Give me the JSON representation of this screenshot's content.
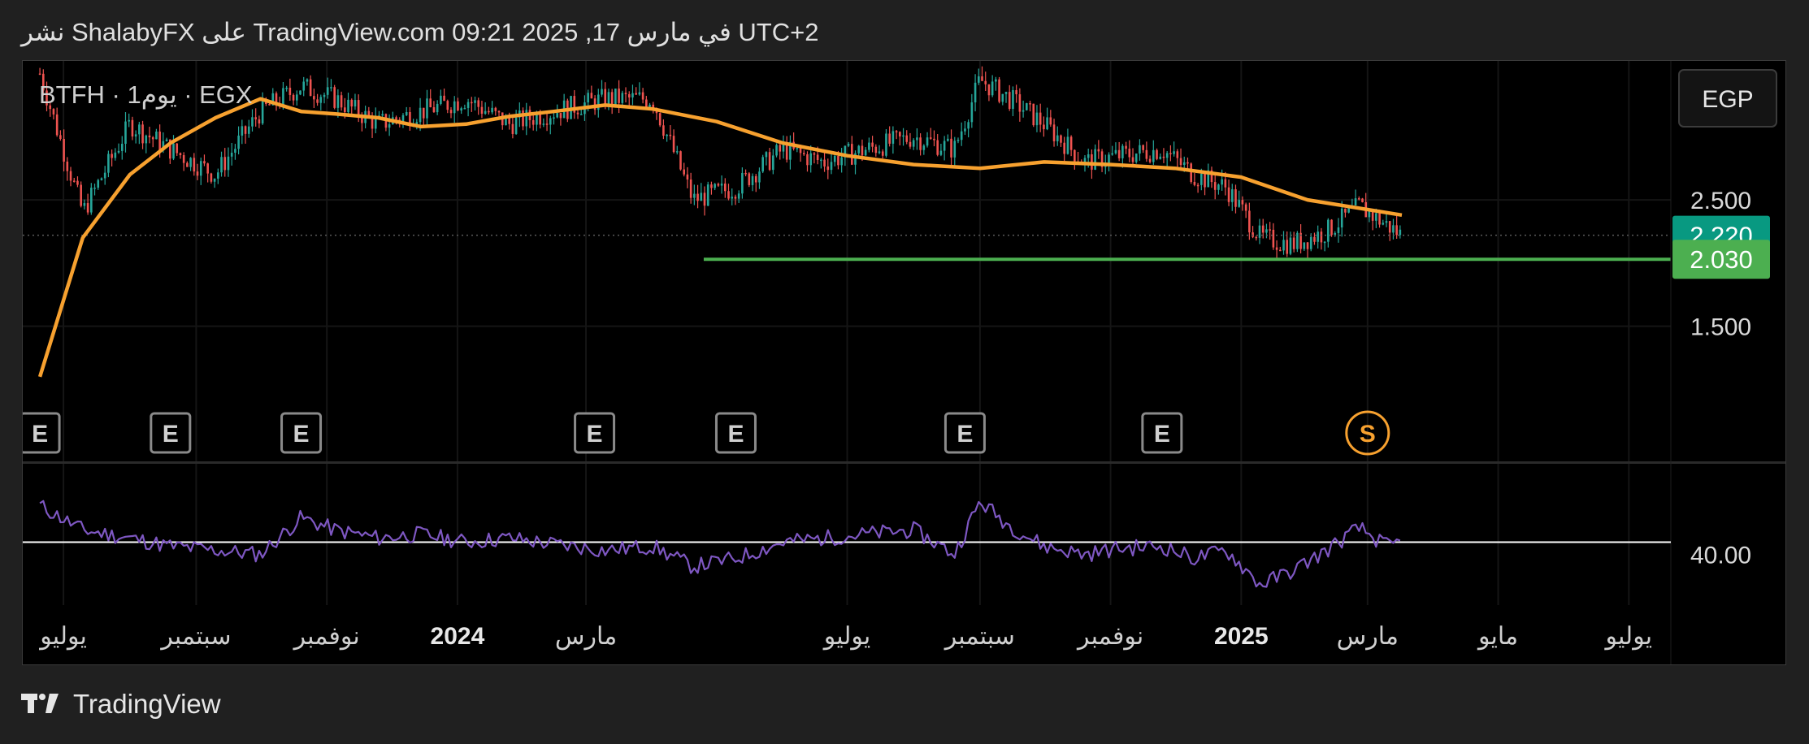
{
  "header": {
    "published_text": "نشر ShalabyFX على TradingView.com 09:21 2025 ,17 في مارس UTC+2"
  },
  "chart_data": {
    "type": "line",
    "symbol_label": "BTFH · 1يوم · EGX",
    "currency_button": "EGP",
    "colors": {
      "background": "#000000",
      "candle_up": "#26a69a",
      "candle_down": "#ef5350",
      "moving_average": "#f7a12f",
      "support_line": "#4caf50",
      "rsi_line": "#7e57c2",
      "rsi_reference": "#ffffff",
      "last_price_badge": "#089981",
      "support_badge": "#4caf50",
      "split_marker": "#f7a12f"
    },
    "price_axis": {
      "tick_labels": [
        "2.500",
        "1.500"
      ],
      "ticks": [
        2.5,
        1.5
      ],
      "ylim": [
        0.9,
        3.6
      ]
    },
    "price_badges": [
      {
        "value": "2.220",
        "kind": "last_price"
      },
      {
        "value": "2.030",
        "kind": "support"
      }
    ],
    "support_level": {
      "value": 2.03,
      "from": "2024-04-25",
      "to": "2025-06-15"
    },
    "x_axis": {
      "tick_labels": [
        {
          "label": "يوليو",
          "date": "2023-07-01",
          "bold": false
        },
        {
          "label": "سبتمبر",
          "date": "2023-09-01",
          "bold": false
        },
        {
          "label": "نوفمبر",
          "date": "2023-11-01",
          "bold": false
        },
        {
          "label": "2024",
          "date": "2024-01-01",
          "bold": true
        },
        {
          "label": "مارس",
          "date": "2024-03-01",
          "bold": false
        },
        {
          "label": "يوليو",
          "date": "2024-07-01",
          "bold": false
        },
        {
          "label": "سبتمبر",
          "date": "2024-09-01",
          "bold": false
        },
        {
          "label": "نوفمبر",
          "date": "2024-11-01",
          "bold": false
        },
        {
          "label": "2025",
          "date": "2025-01-01",
          "bold": true
        },
        {
          "label": "مارس",
          "date": "2025-03-01",
          "bold": false
        },
        {
          "label": "مايو",
          "date": "2025-05-01",
          "bold": false
        },
        {
          "label": "يوليو",
          "date": "2025-07-01",
          "bold": false
        }
      ]
    },
    "price_series": {
      "name": "",
      "dates": [
        "2023-06-20",
        "2023-07-10",
        "2023-08-01",
        "2023-08-20",
        "2023-09-10",
        "2023-10-01",
        "2023-10-20",
        "2023-11-05",
        "2023-11-25",
        "2023-12-15",
        "2024-01-05",
        "2024-01-25",
        "2024-02-15",
        "2024-03-10",
        "2024-04-01",
        "2024-04-20",
        "2024-05-10",
        "2024-06-01",
        "2024-06-20",
        "2024-07-10",
        "2024-08-01",
        "2024-08-20",
        "2024-09-01",
        "2024-09-15",
        "2024-10-01",
        "2024-10-20",
        "2024-11-05",
        "2024-11-25",
        "2024-12-10",
        "2024-12-25",
        "2025-01-10",
        "2025-01-25",
        "2025-02-10",
        "2025-02-25",
        "2025-03-10",
        "2025-03-17"
      ],
      "close": [
        3.5,
        2.4,
        3.1,
        2.9,
        2.7,
        3.2,
        3.4,
        3.3,
        3.1,
        3.2,
        3.3,
        3.1,
        3.2,
        3.3,
        3.3,
        2.5,
        2.6,
        2.9,
        2.8,
        2.9,
        3.0,
        2.9,
        3.45,
        3.3,
        3.1,
        2.8,
        2.85,
        2.9,
        2.7,
        2.6,
        2.2,
        2.15,
        2.25,
        2.45,
        2.3,
        2.22
      ]
    },
    "moving_average": {
      "dates": [
        "2023-06-20",
        "2023-07-10",
        "2023-08-01",
        "2023-08-20",
        "2023-09-10",
        "2023-10-01",
        "2023-10-20",
        "2023-11-05",
        "2023-11-25",
        "2023-12-15",
        "2024-01-05",
        "2024-01-25",
        "2024-02-15",
        "2024-03-10",
        "2024-04-01",
        "2024-05-01",
        "2024-06-01",
        "2024-07-01",
        "2024-08-01",
        "2024-09-01",
        "2024-10-01",
        "2024-11-01",
        "2024-12-01",
        "2025-01-01",
        "2025-02-01",
        "2025-03-17"
      ],
      "values": [
        1.1,
        2.2,
        2.7,
        2.95,
        3.15,
        3.3,
        3.2,
        3.18,
        3.15,
        3.08,
        3.1,
        3.16,
        3.2,
        3.25,
        3.22,
        3.12,
        2.95,
        2.85,
        2.78,
        2.75,
        2.8,
        2.78,
        2.75,
        2.68,
        2.5,
        2.38
      ]
    },
    "event_markers": [
      {
        "label": "E",
        "date": "2023-06-20"
      },
      {
        "label": "E",
        "date": "2023-08-20"
      },
      {
        "label": "E",
        "date": "2023-10-20"
      },
      {
        "label": "E",
        "date": "2024-03-05"
      },
      {
        "label": "E",
        "date": "2024-05-10"
      },
      {
        "label": "E",
        "date": "2024-08-25"
      },
      {
        "label": "E",
        "date": "2024-11-25"
      },
      {
        "label": "S",
        "date": "2025-03-01"
      }
    ],
    "rsi": {
      "tick_labels": [
        "40.00"
      ],
      "ticks": [
        40
      ],
      "reference_level": 46,
      "ylim": [
        15,
        85
      ],
      "dates": [
        "2023-06-20",
        "2023-07-10",
        "2023-08-01",
        "2023-08-20",
        "2023-09-10",
        "2023-10-01",
        "2023-10-20",
        "2023-11-05",
        "2023-11-25",
        "2023-12-15",
        "2024-01-05",
        "2024-01-25",
        "2024-02-15",
        "2024-03-10",
        "2024-04-01",
        "2024-04-20",
        "2024-05-10",
        "2024-06-01",
        "2024-06-20",
        "2024-07-10",
        "2024-08-01",
        "2024-08-20",
        "2024-09-01",
        "2024-09-15",
        "2024-10-01",
        "2024-10-20",
        "2024-11-05",
        "2024-11-25",
        "2024-12-10",
        "2024-12-25",
        "2025-01-10",
        "2025-01-25",
        "2025-02-10",
        "2025-02-25",
        "2025-03-10",
        "2025-03-17"
      ],
      "values": [
        64,
        52,
        48,
        44,
        42,
        40,
        58,
        52,
        48,
        50,
        46,
        48,
        45,
        42,
        44,
        34,
        38,
        46,
        48,
        50,
        52,
        40,
        66,
        54,
        44,
        40,
        43,
        44,
        38,
        42,
        25,
        32,
        42,
        53,
        44,
        46
      ]
    }
  }
}
